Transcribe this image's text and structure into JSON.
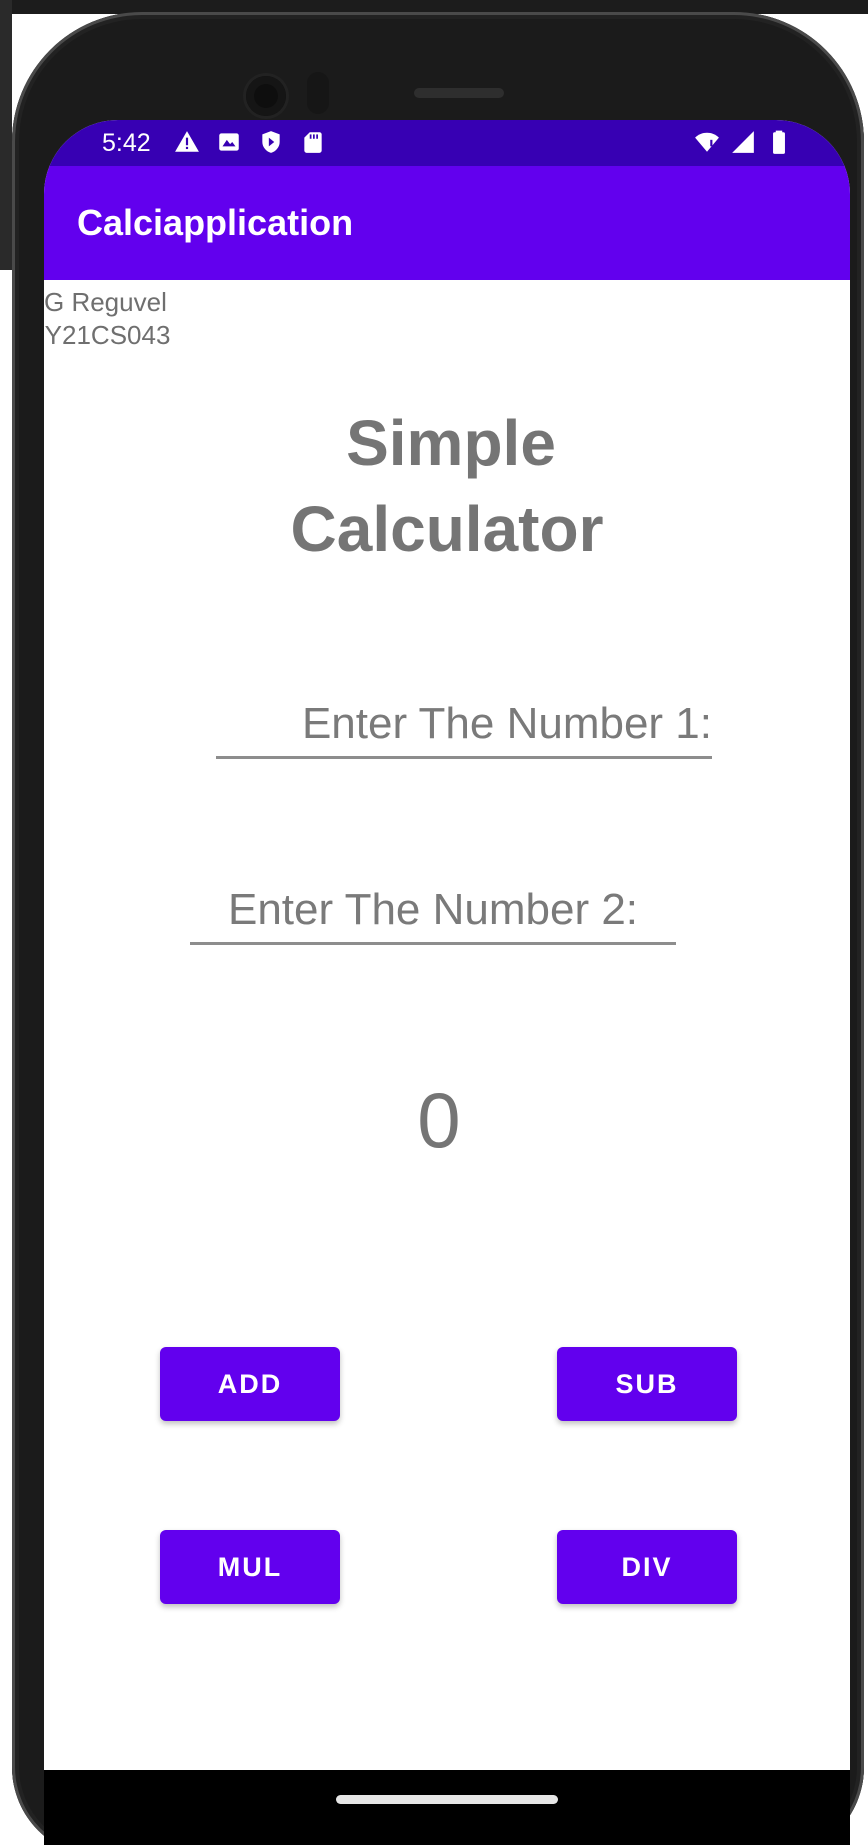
{
  "status_bar": {
    "time": "5:42",
    "left_icons": [
      "warning-icon",
      "photo-notification-icon",
      "shield-play-icon",
      "sd-card-icon"
    ],
    "right_icons": [
      "wifi-icon",
      "cellular-signal-icon",
      "battery-icon"
    ],
    "color": "#3700b3"
  },
  "app_bar": {
    "title": "Calciapplication",
    "color": "#6200ee"
  },
  "student": {
    "name": "G Reguvel",
    "id": "-Y21CS043"
  },
  "heading": {
    "line1": "Simple",
    "line2": "Calculator"
  },
  "inputs": {
    "number1": {
      "value": "",
      "placeholder": "Enter The Number 1:"
    },
    "number2": {
      "value": "",
      "placeholder": "Enter The Number 2:"
    }
  },
  "result": "0",
  "buttons": {
    "add": "ADD",
    "sub": "SUB",
    "mul": "MUL",
    "div": "DIV",
    "color": "#6200ee"
  }
}
